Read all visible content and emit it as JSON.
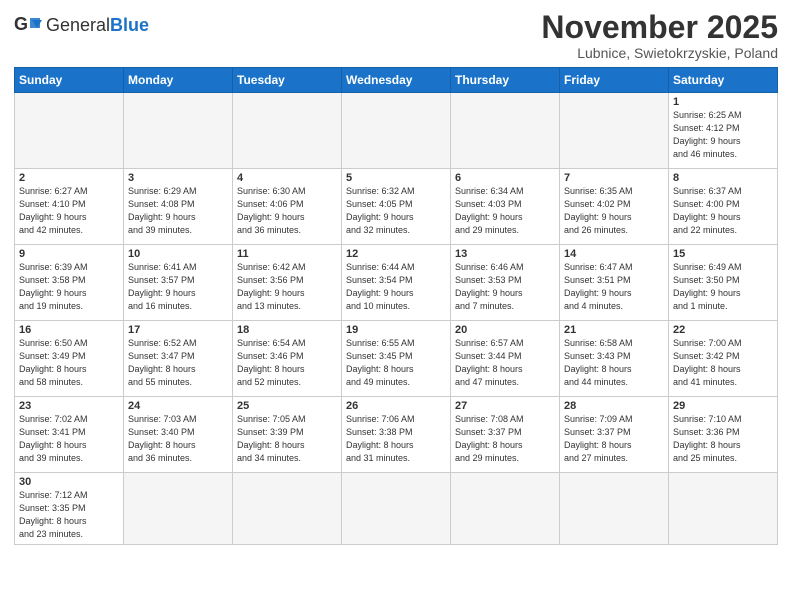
{
  "logo": {
    "text_general": "General",
    "text_blue": "Blue"
  },
  "title": "November 2025",
  "subtitle": "Lubnice, Swietokrzyskie, Poland",
  "days_of_week": [
    "Sunday",
    "Monday",
    "Tuesday",
    "Wednesday",
    "Thursday",
    "Friday",
    "Saturday"
  ],
  "weeks": [
    [
      {
        "day": "",
        "info": "",
        "empty": true
      },
      {
        "day": "",
        "info": "",
        "empty": true
      },
      {
        "day": "",
        "info": "",
        "empty": true
      },
      {
        "day": "",
        "info": "",
        "empty": true
      },
      {
        "day": "",
        "info": "",
        "empty": true
      },
      {
        "day": "",
        "info": "",
        "empty": true
      },
      {
        "day": "1",
        "info": "Sunrise: 6:25 AM\nSunset: 4:12 PM\nDaylight: 9 hours\nand 46 minutes."
      }
    ],
    [
      {
        "day": "2",
        "info": "Sunrise: 6:27 AM\nSunset: 4:10 PM\nDaylight: 9 hours\nand 42 minutes."
      },
      {
        "day": "3",
        "info": "Sunrise: 6:29 AM\nSunset: 4:08 PM\nDaylight: 9 hours\nand 39 minutes."
      },
      {
        "day": "4",
        "info": "Sunrise: 6:30 AM\nSunset: 4:06 PM\nDaylight: 9 hours\nand 36 minutes."
      },
      {
        "day": "5",
        "info": "Sunrise: 6:32 AM\nSunset: 4:05 PM\nDaylight: 9 hours\nand 32 minutes."
      },
      {
        "day": "6",
        "info": "Sunrise: 6:34 AM\nSunset: 4:03 PM\nDaylight: 9 hours\nand 29 minutes."
      },
      {
        "day": "7",
        "info": "Sunrise: 6:35 AM\nSunset: 4:02 PM\nDaylight: 9 hours\nand 26 minutes."
      },
      {
        "day": "8",
        "info": "Sunrise: 6:37 AM\nSunset: 4:00 PM\nDaylight: 9 hours\nand 22 minutes."
      }
    ],
    [
      {
        "day": "9",
        "info": "Sunrise: 6:39 AM\nSunset: 3:58 PM\nDaylight: 9 hours\nand 19 minutes."
      },
      {
        "day": "10",
        "info": "Sunrise: 6:41 AM\nSunset: 3:57 PM\nDaylight: 9 hours\nand 16 minutes."
      },
      {
        "day": "11",
        "info": "Sunrise: 6:42 AM\nSunset: 3:56 PM\nDaylight: 9 hours\nand 13 minutes."
      },
      {
        "day": "12",
        "info": "Sunrise: 6:44 AM\nSunset: 3:54 PM\nDaylight: 9 hours\nand 10 minutes."
      },
      {
        "day": "13",
        "info": "Sunrise: 6:46 AM\nSunset: 3:53 PM\nDaylight: 9 hours\nand 7 minutes."
      },
      {
        "day": "14",
        "info": "Sunrise: 6:47 AM\nSunset: 3:51 PM\nDaylight: 9 hours\nand 4 minutes."
      },
      {
        "day": "15",
        "info": "Sunrise: 6:49 AM\nSunset: 3:50 PM\nDaylight: 9 hours\nand 1 minute."
      }
    ],
    [
      {
        "day": "16",
        "info": "Sunrise: 6:50 AM\nSunset: 3:49 PM\nDaylight: 8 hours\nand 58 minutes."
      },
      {
        "day": "17",
        "info": "Sunrise: 6:52 AM\nSunset: 3:47 PM\nDaylight: 8 hours\nand 55 minutes."
      },
      {
        "day": "18",
        "info": "Sunrise: 6:54 AM\nSunset: 3:46 PM\nDaylight: 8 hours\nand 52 minutes."
      },
      {
        "day": "19",
        "info": "Sunrise: 6:55 AM\nSunset: 3:45 PM\nDaylight: 8 hours\nand 49 minutes."
      },
      {
        "day": "20",
        "info": "Sunrise: 6:57 AM\nSunset: 3:44 PM\nDaylight: 8 hours\nand 47 minutes."
      },
      {
        "day": "21",
        "info": "Sunrise: 6:58 AM\nSunset: 3:43 PM\nDaylight: 8 hours\nand 44 minutes."
      },
      {
        "day": "22",
        "info": "Sunrise: 7:00 AM\nSunset: 3:42 PM\nDaylight: 8 hours\nand 41 minutes."
      }
    ],
    [
      {
        "day": "23",
        "info": "Sunrise: 7:02 AM\nSunset: 3:41 PM\nDaylight: 8 hours\nand 39 minutes."
      },
      {
        "day": "24",
        "info": "Sunrise: 7:03 AM\nSunset: 3:40 PM\nDaylight: 8 hours\nand 36 minutes."
      },
      {
        "day": "25",
        "info": "Sunrise: 7:05 AM\nSunset: 3:39 PM\nDaylight: 8 hours\nand 34 minutes."
      },
      {
        "day": "26",
        "info": "Sunrise: 7:06 AM\nSunset: 3:38 PM\nDaylight: 8 hours\nand 31 minutes."
      },
      {
        "day": "27",
        "info": "Sunrise: 7:08 AM\nSunset: 3:37 PM\nDaylight: 8 hours\nand 29 minutes."
      },
      {
        "day": "28",
        "info": "Sunrise: 7:09 AM\nSunset: 3:37 PM\nDaylight: 8 hours\nand 27 minutes."
      },
      {
        "day": "29",
        "info": "Sunrise: 7:10 AM\nSunset: 3:36 PM\nDaylight: 8 hours\nand 25 minutes."
      }
    ],
    [
      {
        "day": "30",
        "info": "Sunrise: 7:12 AM\nSunset: 3:35 PM\nDaylight: 8 hours\nand 23 minutes."
      },
      {
        "day": "",
        "info": "",
        "empty": true
      },
      {
        "day": "",
        "info": "",
        "empty": true
      },
      {
        "day": "",
        "info": "",
        "empty": true
      },
      {
        "day": "",
        "info": "",
        "empty": true
      },
      {
        "day": "",
        "info": "",
        "empty": true
      },
      {
        "day": "",
        "info": "",
        "empty": true
      }
    ]
  ]
}
